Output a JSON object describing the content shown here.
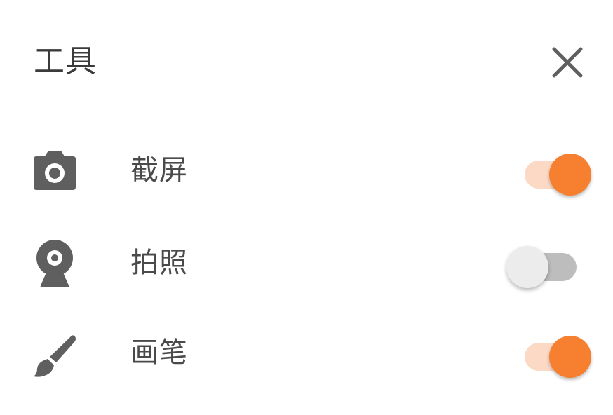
{
  "header": {
    "title": "工具",
    "close_icon": "close-icon"
  },
  "tools": [
    {
      "label": "截屏",
      "icon": "camera-icon",
      "enabled": true
    },
    {
      "label": "拍照",
      "icon": "webcam-icon",
      "enabled": false
    },
    {
      "label": "画笔",
      "icon": "brush-icon",
      "enabled": true
    }
  ],
  "colors": {
    "accent": "#f6802f",
    "accent_track": "#fbd9c4",
    "off_track": "#bdbdbd",
    "off_knob": "#ececec",
    "icon": "#5f5f5f",
    "text": "#4a4a4a"
  }
}
